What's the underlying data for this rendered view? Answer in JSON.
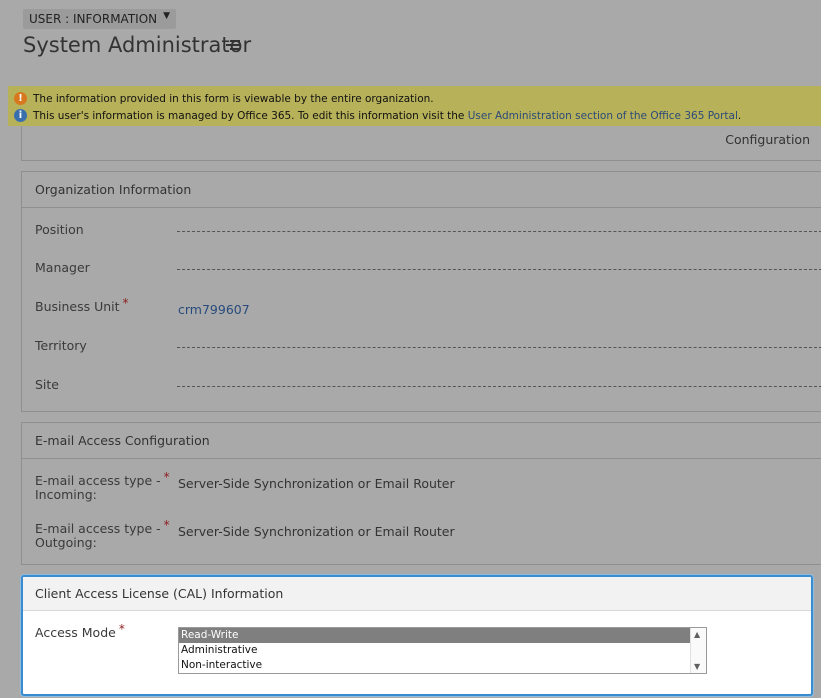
{
  "header": {
    "form_selector": "USER : INFORMATION",
    "title": "System Administrator"
  },
  "notifications": {
    "warning_text": "The information provided in this form is viewable by the entire organization.",
    "info_text_prefix": "This user's information is managed by Office 365. To edit this information visit the ",
    "info_link": "User Administration section of the Office 365 Portal",
    "info_text_suffix": "."
  },
  "previous_section": {
    "label": "Configuration"
  },
  "organization": {
    "title": "Organization Information",
    "fields": {
      "position": {
        "label": "Position"
      },
      "manager": {
        "label": "Manager"
      },
      "business_unit": {
        "label": "Business Unit",
        "value": "crm799607",
        "required": "*"
      },
      "territory": {
        "label": "Territory"
      },
      "site": {
        "label": "Site"
      }
    }
  },
  "email": {
    "title": "E-mail Access Configuration",
    "incoming": {
      "label_line1": "E-mail access type -",
      "label_line2": "Incoming:",
      "value": "Server-Side Synchronization or Email Router",
      "required": "*"
    },
    "outgoing": {
      "label_line1": "E-mail access type -",
      "label_line2": "Outgoing:",
      "value": "Server-Side Synchronization or Email Router",
      "required": "*"
    }
  },
  "cal": {
    "title": "Client Access License (CAL) Information",
    "access_mode": {
      "label": "Access Mode",
      "required": "*",
      "options": [
        "Read-Write",
        "Administrative",
        "Non-interactive"
      ],
      "selected": "Read-Write"
    }
  },
  "colors": {
    "notification_bar": "#b7b15a",
    "overlay": "#a9a9a9",
    "focus_border": "#3a8ccf",
    "required": "#8e1b1b"
  }
}
